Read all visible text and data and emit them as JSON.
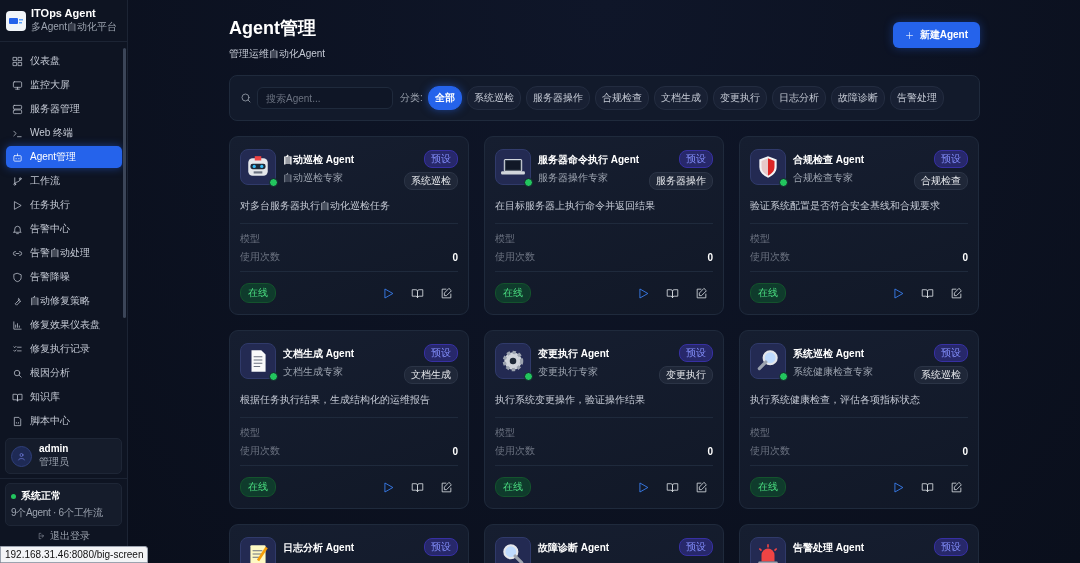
{
  "app": {
    "name": "ITOps Agent",
    "subtitle": "多Agent自动化平台"
  },
  "sidebar": {
    "items": [
      {
        "label": "仪表盘",
        "selected": false
      },
      {
        "label": "监控大屏",
        "selected": false
      },
      {
        "label": "服务器管理",
        "selected": false
      },
      {
        "label": "Web 终端",
        "selected": false
      },
      {
        "label": "Agent管理",
        "selected": true
      },
      {
        "label": "工作流",
        "selected": false
      },
      {
        "label": "任务执行",
        "selected": false
      },
      {
        "label": "告警中心",
        "selected": false
      },
      {
        "label": "告警自动处理",
        "selected": false
      },
      {
        "label": "告警降噪",
        "selected": false
      },
      {
        "label": "自动修复策略",
        "selected": false
      },
      {
        "label": "修复效果仪表盘",
        "selected": false
      },
      {
        "label": "修复执行记录",
        "selected": false
      },
      {
        "label": "根因分析",
        "selected": false
      },
      {
        "label": "知识库",
        "selected": false
      },
      {
        "label": "脚本中心",
        "selected": false
      }
    ],
    "user": {
      "name": "admin",
      "role": "管理员"
    },
    "system_status": {
      "title": "系统正常",
      "ok": true,
      "detail": "9个Agent · 6个工作流"
    },
    "logout": "退出登录"
  },
  "header": {
    "title": "Agent管理",
    "subtitle": "管理运维自动化Agent",
    "new_button": "新建Agent"
  },
  "filter": {
    "search_placeholder": "搜索Agent...",
    "category_label": "分类:",
    "categories": [
      {
        "label": "全部",
        "selected": true
      },
      {
        "label": "系统巡检",
        "selected": false
      },
      {
        "label": "服务器操作",
        "selected": false
      },
      {
        "label": "合规检查",
        "selected": false
      },
      {
        "label": "文档生成",
        "selected": false
      },
      {
        "label": "变更执行",
        "selected": false
      },
      {
        "label": "日志分析",
        "selected": false
      },
      {
        "label": "故障诊断",
        "selected": false
      },
      {
        "label": "告警处理",
        "selected": false
      }
    ]
  },
  "agents": [
    {
      "name": "自动巡检 Agent",
      "role": "自动巡检专家",
      "badge": "预设",
      "category": "系统巡检",
      "description": "对多台服务器执行自动化巡检任务",
      "model_label": "模型",
      "usage_label": "使用次数",
      "usage": "0",
      "status": "在线",
      "online": true
    },
    {
      "name": "服务器命令执行 Agent",
      "role": "服务器操作专家",
      "badge": "预设",
      "category": "服务器操作",
      "description": "在目标服务器上执行命令并返回结果",
      "model_label": "模型",
      "usage_label": "使用次数",
      "usage": "0",
      "status": "在线",
      "online": true
    },
    {
      "name": "合规检查 Agent",
      "role": "合规检查专家",
      "badge": "预设",
      "category": "合规检查",
      "description": "验证系统配置是否符合安全基线和合规要求",
      "model_label": "模型",
      "usage_label": "使用次数",
      "usage": "0",
      "status": "在线",
      "online": true
    },
    {
      "name": "文档生成 Agent",
      "role": "文档生成专家",
      "badge": "预设",
      "category": "文档生成",
      "description": "根据任务执行结果，生成结构化的运维报告",
      "model_label": "模型",
      "usage_label": "使用次数",
      "usage": "0",
      "status": "在线",
      "online": true
    },
    {
      "name": "变更执行 Agent",
      "role": "变更执行专家",
      "badge": "预设",
      "category": "变更执行",
      "description": "执行系统变更操作，验证操作结果",
      "model_label": "模型",
      "usage_label": "使用次数",
      "usage": "0",
      "status": "在线",
      "online": true
    },
    {
      "name": "系统巡检 Agent",
      "role": "系统健康检查专家",
      "badge": "预设",
      "category": "系统巡检",
      "description": "执行系统健康检查，评估各项指标状态",
      "model_label": "模型",
      "usage_label": "使用次数",
      "usage": "0",
      "status": "在线",
      "online": true
    },
    {
      "name": "日志分析 Agent",
      "badge": "预设"
    },
    {
      "name": "故障诊断 Agent",
      "badge": "预设"
    },
    {
      "name": "告警处理 Agent",
      "badge": "预设"
    }
  ],
  "status_url": "192.168.31.46:8080/big-screen"
}
